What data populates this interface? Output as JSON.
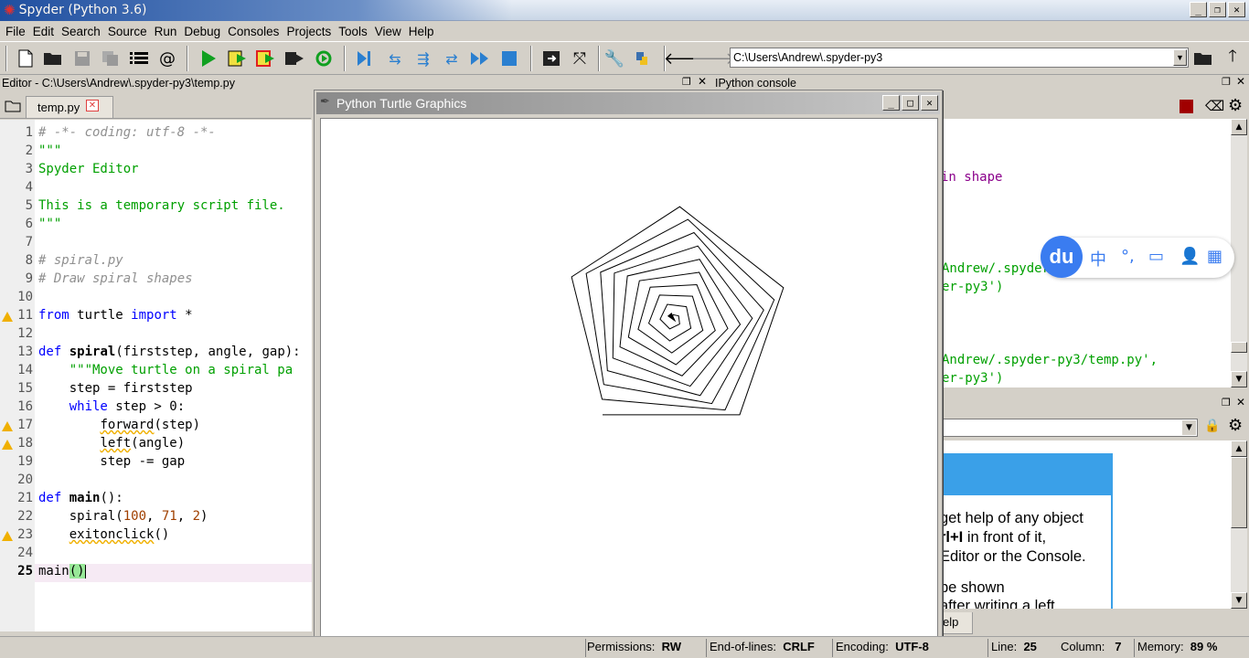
{
  "window": {
    "title": "Spyder (Python 3.6)",
    "min": "_",
    "max": "❐",
    "close": "✕"
  },
  "menu": [
    "File",
    "Edit",
    "Search",
    "Source",
    "Run",
    "Debug",
    "Consoles",
    "Projects",
    "Tools",
    "View",
    "Help"
  ],
  "toolbar": {
    "path": "C:\\Users\\Andrew\\.spyder-py3"
  },
  "editor": {
    "header": "Editor - C:\\Users\\Andrew\\.spyder-py3\\temp.py",
    "tab": "temp.py",
    "current_line": "25",
    "lines": [
      {
        "n": "1"
      },
      {
        "n": "2"
      },
      {
        "n": "3"
      },
      {
        "n": "4"
      },
      {
        "n": "5"
      },
      {
        "n": "6"
      },
      {
        "n": "7"
      },
      {
        "n": "8"
      },
      {
        "n": "9"
      },
      {
        "n": "10"
      },
      {
        "n": "11"
      },
      {
        "n": "12"
      },
      {
        "n": "13"
      },
      {
        "n": "14"
      },
      {
        "n": "15"
      },
      {
        "n": "16"
      },
      {
        "n": "17"
      },
      {
        "n": "18"
      },
      {
        "n": "19"
      },
      {
        "n": "20"
      },
      {
        "n": "21"
      },
      {
        "n": "22"
      },
      {
        "n": "23"
      },
      {
        "n": "24"
      }
    ],
    "code": {
      "l1": "# -*- coding: utf-8 -*-",
      "l2": "\"\"\"",
      "l3": "Spyder Editor",
      "l5": "This is a temporary script file.",
      "l6": "\"\"\"",
      "l8": "# spiral.py",
      "l9": "# Draw spiral shapes",
      "l11_from": "from",
      "l11_mod": " turtle ",
      "l11_import": "import",
      "l11_star": " *",
      "l13_def": "def",
      "l13_name": " spiral",
      "l13_args": "(firststep, angle, gap):",
      "l14": "    \"\"\"Move turtle on a spiral pa",
      "l15": "    step = firststep",
      "l16_kw": "    while",
      "l16_rest": " step > 0:",
      "l17_ind": "        ",
      "l17_fn": "forward",
      "l17_rest": "(step)",
      "l18_ind": "        ",
      "l18_fn": "left",
      "l18_rest": "(angle)",
      "l19": "        step -= gap",
      "l21_def": "def",
      "l21_name": " main",
      "l21_rest": "():",
      "l22_a": "    spiral(",
      "l22_n1": "100",
      "l22_c1": ", ",
      "l22_n2": "71",
      "l22_c2": ", ",
      "l22_n3": "2",
      "l22_b": ")",
      "l23_ind": "    ",
      "l23_fn": "exitonclick",
      "l23_rest": "()",
      "l25_a": "main",
      "l25_b": "()"
    }
  },
  "ipython": {
    "header": "IPython console",
    "lines": {
      "a": "in shape",
      "b1": "Andrew/.spyder",
      "b2": "er-py3')",
      "c1": "Andrew/.spyder-py3/temp.py',",
      "c2": "er-py3')"
    }
  },
  "help": {
    "text1": "get help of any object",
    "text2_b": "rl+I",
    "text2": " in front of it,",
    "text3": "Editor or the Console.",
    "text4": "be shown",
    "text5": "after writing a left",
    "tab": "elp"
  },
  "turtle": {
    "title": "Python Turtle Graphics",
    "min": "_",
    "max": "□",
    "close": "✕"
  },
  "ime": {
    "logo": "du",
    "zh": "中",
    "punct": "°,"
  },
  "status": {
    "permissions_label": "Permissions:",
    "permissions": "RW",
    "eol_label": "End-of-lines:",
    "eol": "CRLF",
    "encoding_label": "Encoding:",
    "encoding": "UTF-8",
    "line_label": "Line:",
    "line": "25",
    "column_label": "Column:",
    "column": "7",
    "memory_label": "Memory:",
    "memory": "89 %"
  }
}
